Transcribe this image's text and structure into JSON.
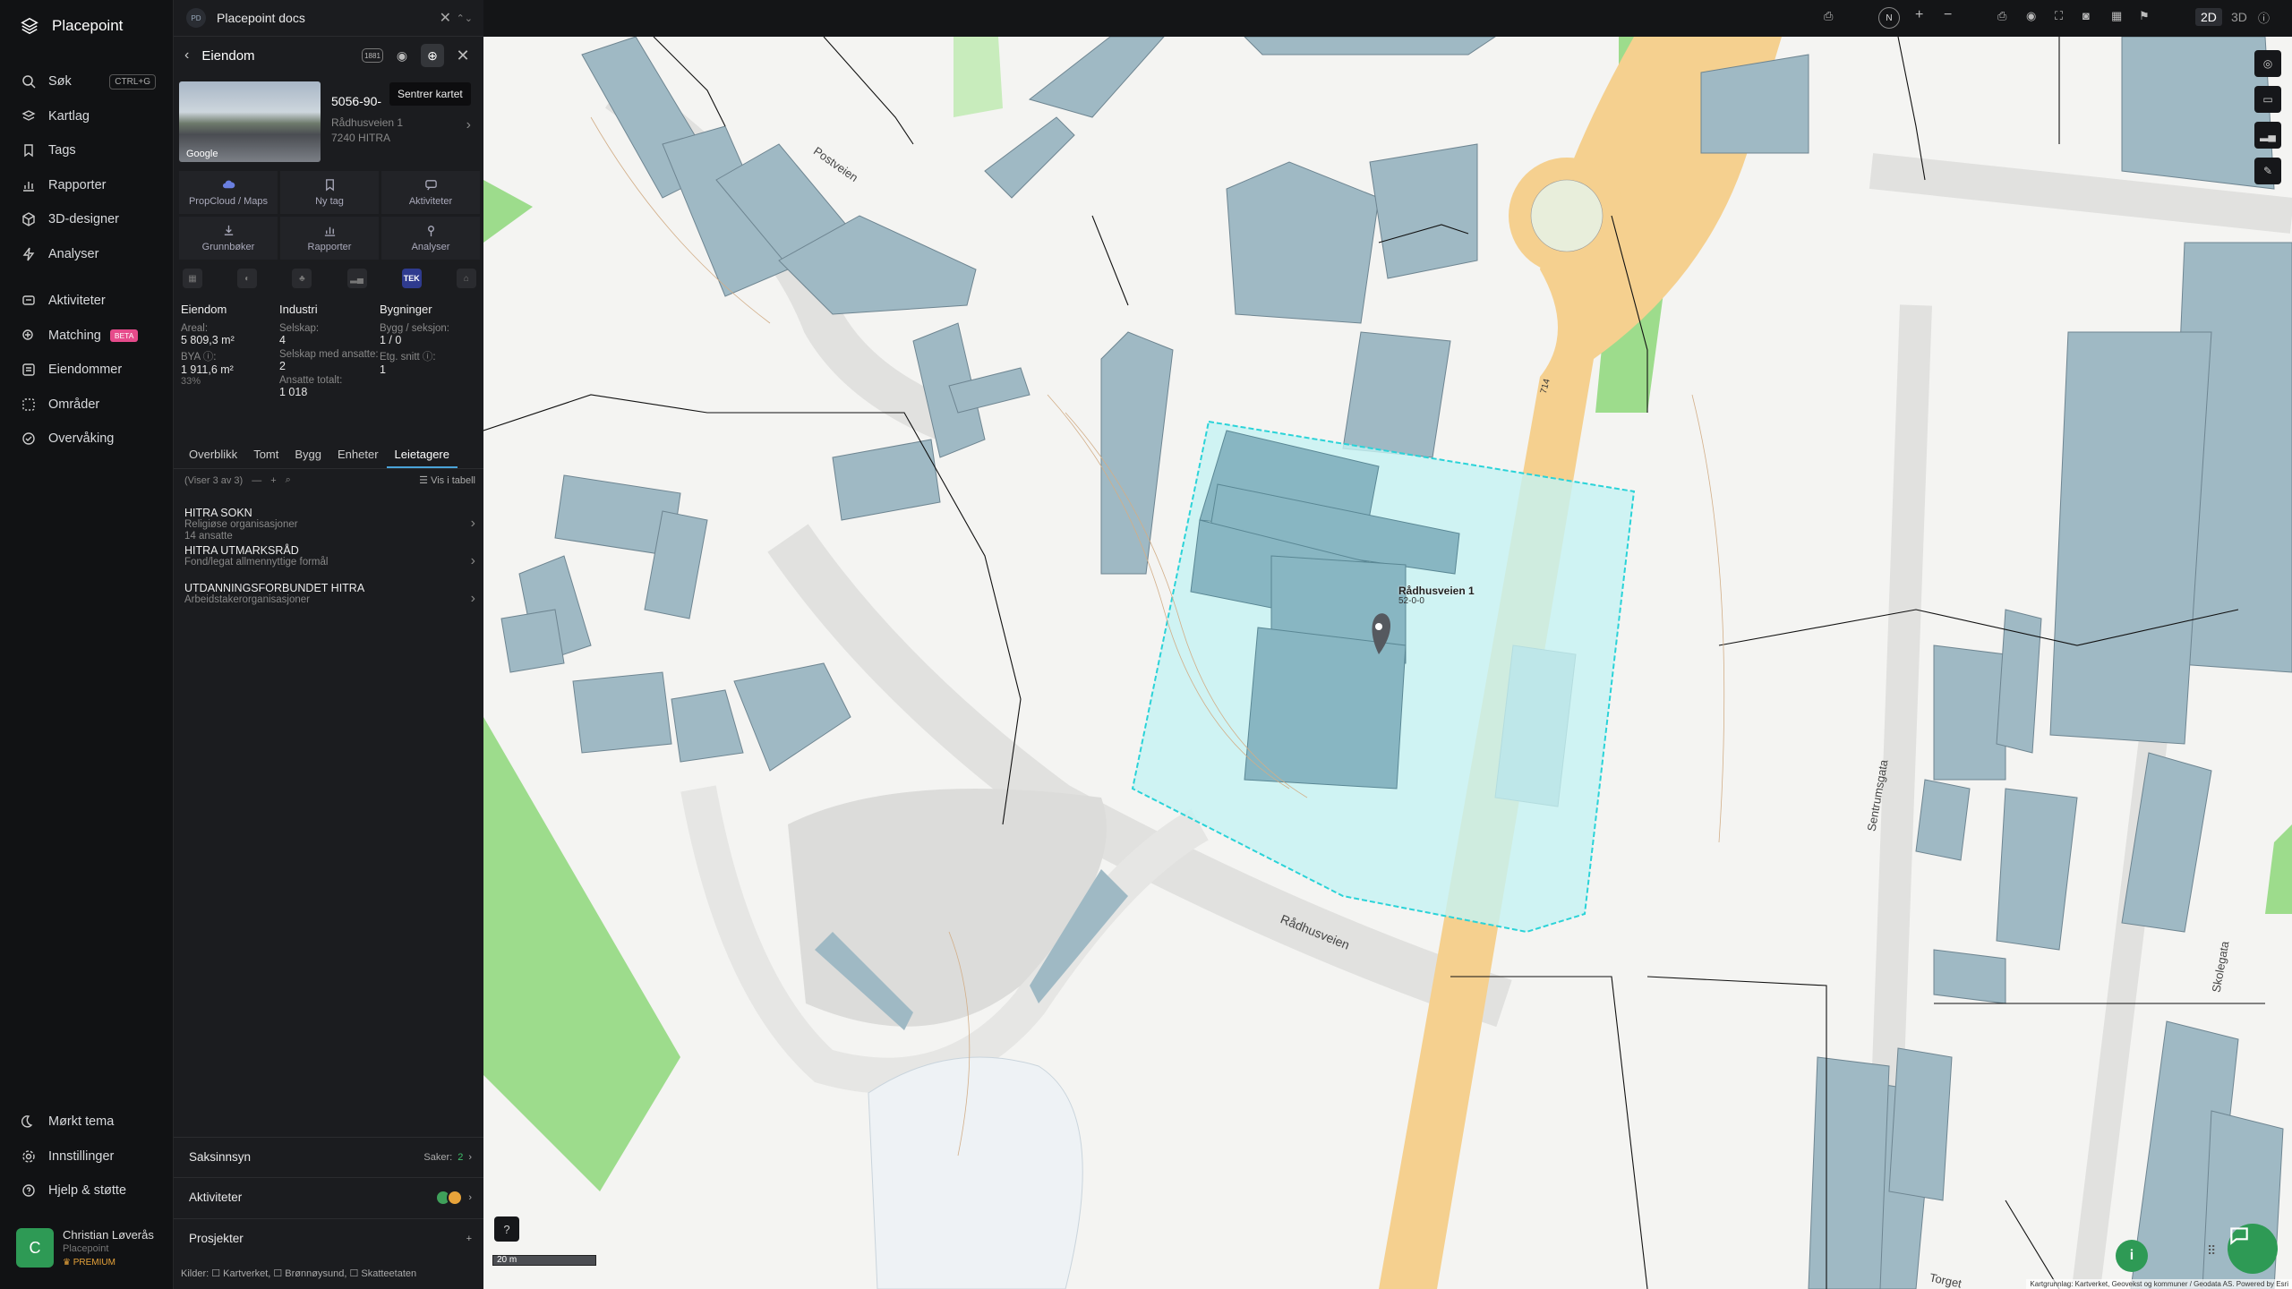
{
  "app": {
    "brand": "Placepoint"
  },
  "nav": {
    "items": [
      {
        "label": "Søk",
        "shortcut": "CTRL+G"
      },
      {
        "label": "Kartlag"
      },
      {
        "label": "Tags"
      },
      {
        "label": "Rapporter"
      },
      {
        "label": "3D-designer"
      },
      {
        "label": "Analyser"
      },
      {
        "label": "Aktiviteter"
      },
      {
        "label": "Matching",
        "badge": "BETA"
      },
      {
        "label": "Eiendommer"
      },
      {
        "label": "Områder"
      },
      {
        "label": "Overvåking"
      }
    ],
    "bottom": [
      {
        "label": "Mørkt tema"
      },
      {
        "label": "Innstillinger"
      },
      {
        "label": "Hjelp & støtte"
      }
    ],
    "user": {
      "initial": "C",
      "name": "Christian Løverås",
      "org": "Placepoint",
      "plan": "PREMIUM"
    }
  },
  "panel": {
    "doc": {
      "badge": "PD",
      "title": "Placepoint docs"
    },
    "header": {
      "title": "Eiendom",
      "tooltip": "Sentrer kartet",
      "tag": "1881"
    },
    "property": {
      "id": "5056-90-",
      "address1": "Rådhusveien 1",
      "address2": "7240 HITRA",
      "photo_credit": "Google"
    },
    "actions": [
      "PropCloud / Maps",
      "Ny tag",
      "Aktiviteter",
      "Grunnbøker",
      "Rapporter",
      "Analyser"
    ],
    "layer_tek": "TEK",
    "stats": {
      "eiendom": {
        "title": "Eiendom",
        "areal_label": "Areal:",
        "areal": "5 809,3 m²",
        "bya_label": "BYA ⓘ:",
        "bya": "1 911,6 m²",
        "bya_pct": "33%"
      },
      "industri": {
        "title": "Industri",
        "selskap_label": "Selskap:",
        "selskap": "4",
        "ansatte_label": "Selskap med ansatte:",
        "ansatte": "2",
        "totalt_label": "Ansatte totalt:",
        "totalt": "1 018"
      },
      "bygninger": {
        "title": "Bygninger",
        "bygg_label": "Bygg / seksjon:",
        "bygg": "1 / 0",
        "etg_label": "Etg. snitt ⓘ:",
        "etg": "1"
      }
    },
    "tabs": [
      "Overblikk",
      "Tomt",
      "Bygg",
      "Enheter",
      "Leietagere"
    ],
    "active_tab": "Leietagere",
    "showing": "(Viser 3 av 3)",
    "table_link": "Vis i tabell",
    "tenants": [
      {
        "name": "HITRA SOKN",
        "category": "Religiøse organisasjoner",
        "extra": "14 ansatte"
      },
      {
        "name": "HITRA UTMARKSRÅD",
        "category": "Fond/legat allmennyttige formål",
        "extra": ""
      },
      {
        "name": "UTDANNINGSFORBUNDET HITRA",
        "category": "Arbeidstakerorganisasjoner",
        "extra": ""
      }
    ],
    "sections": {
      "saksinnsyn": "Saksinnsyn",
      "saker_label": "Saker:",
      "saker": "2",
      "aktiviteter": "Aktiviteter",
      "prosjekter": "Prosjekter"
    },
    "sources": "Kilder:  ☐ Kartverket,  ☐ Brønnøysund,  ☐ Skatteetaten"
  },
  "map": {
    "view_2d": "2D",
    "view_3d": "3D",
    "north": "N",
    "marker_label": "Rådhusveien 1",
    "marker_sub": "52-0-0",
    "scale": "20 m",
    "attribution": "Kartgrunnlag: Kartverket, Geovekst og kommuner / Geodata AS. Powered by Esri",
    "labels": {
      "road1": "Rådhusveien",
      "road2": "Postveien",
      "road3": "Sentrumsgata",
      "road4": "Skolegata",
      "road5": "Torget",
      "route": "714"
    },
    "colors": {
      "selection": "#2ad3d8",
      "building": "#9fb9c4",
      "green": "#9ddc8c",
      "road": "#f5d08f"
    }
  }
}
